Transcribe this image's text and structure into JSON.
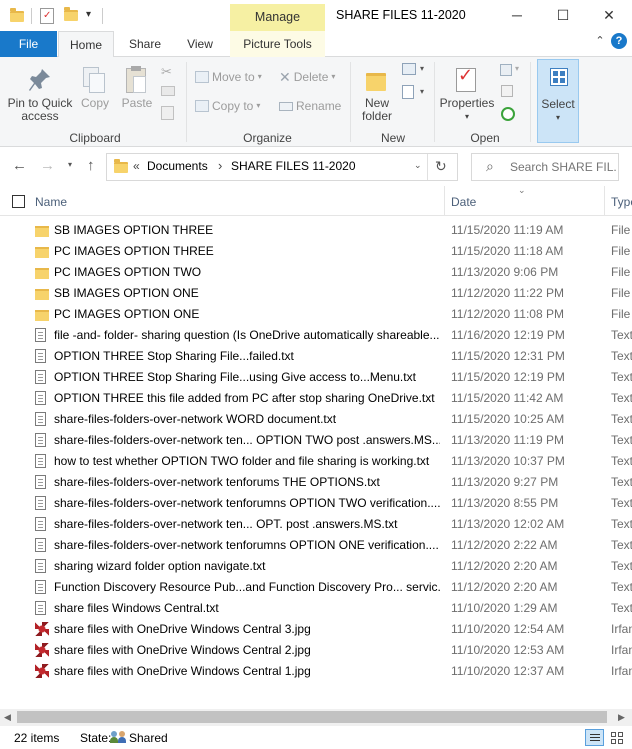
{
  "window": {
    "title": "SHARE FILES 11-2020",
    "manage_label": "Manage",
    "minimize": "─",
    "maximize": "☐",
    "close": "✕"
  },
  "ribbon_tabs": {
    "file": "File",
    "home": "Home",
    "share": "Share",
    "view": "View",
    "picture_tools": "Picture Tools"
  },
  "ribbon": {
    "clipboard": {
      "label": "Clipboard",
      "pin_line1": "Pin to Quick",
      "pin_line2": "access",
      "copy": "Copy",
      "paste": "Paste"
    },
    "organize": {
      "label": "Organize",
      "move_to": "Move to",
      "copy_to": "Copy to",
      "delete": "Delete",
      "rename": "Rename"
    },
    "new": {
      "label": "New",
      "new_folder_line1": "New",
      "new_folder_line2": "folder"
    },
    "open": {
      "label": "Open",
      "properties": "Properties"
    },
    "select": {
      "label": "Select"
    }
  },
  "nav": {
    "breadcrumb_sep": "«",
    "path": [
      "Documents",
      "SHARE FILES 11-2020"
    ],
    "path_arrow": "›",
    "search_placeholder": "Search SHARE FIL..."
  },
  "columns": {
    "name": "Name",
    "date": "Date",
    "type": "Type"
  },
  "files": [
    {
      "name": "SB IMAGES OPTION THREE",
      "date": "11/15/2020 11:19 AM",
      "type": "File",
      "kind": "folder"
    },
    {
      "name": "PC IMAGES OPTION THREE",
      "date": "11/15/2020 11:18 AM",
      "type": "File",
      "kind": "folder"
    },
    {
      "name": "PC IMAGES OPTION TWO",
      "date": "11/13/2020 9:06 PM",
      "type": "File",
      "kind": "folder"
    },
    {
      "name": "SB IMAGES OPTION ONE",
      "date": "11/12/2020 11:22 PM",
      "type": "File",
      "kind": "folder"
    },
    {
      "name": "PC IMAGES OPTION ONE",
      "date": "11/12/2020 11:08 PM",
      "type": "File",
      "kind": "folder"
    },
    {
      "name": "file -and- folder- sharing question (Is OneDrive automatically shareable...",
      "date": "11/16/2020 12:19 PM",
      "type": "Text",
      "kind": "text"
    },
    {
      "name": "OPTION THREE Stop Sharing File...failed.txt",
      "date": "11/15/2020 12:31 PM",
      "type": "Text",
      "kind": "text"
    },
    {
      "name": "OPTION THREE Stop Sharing File...using Give access to...Menu.txt",
      "date": "11/15/2020 12:19 PM",
      "type": "Text",
      "kind": "text"
    },
    {
      "name": "OPTION THREE this file added from PC after stop sharing OneDrive.txt",
      "date": "11/15/2020 11:42 AM",
      "type": "Text",
      "kind": "text"
    },
    {
      "name": "share-files-folders-over-network WORD document.txt",
      "date": "11/15/2020 10:25 AM",
      "type": "Text",
      "kind": "text"
    },
    {
      "name": "share-files-folders-over-network ten... OPTION TWO post .answers.MS....",
      "date": "11/13/2020 11:19 PM",
      "type": "Text",
      "kind": "text"
    },
    {
      "name": "how to test whether OPTION TWO  folder and file sharing is working.txt",
      "date": "11/13/2020 10:37 PM",
      "type": "Text",
      "kind": "text"
    },
    {
      "name": "share-files-folders-over-network tenforums THE OPTIONS.txt",
      "date": "11/13/2020 9:27 PM",
      "type": "Text",
      "kind": "text"
    },
    {
      "name": "share-files-folders-over-network tenforumns OPTION TWO verification....",
      "date": "11/13/2020 8:55 PM",
      "type": "Text",
      "kind": "text"
    },
    {
      "name": "share-files-folders-over-network ten... OPT. post .answers.MS.txt",
      "date": "11/13/2020 12:02 AM",
      "type": "Text",
      "kind": "text"
    },
    {
      "name": "share-files-folders-over-network tenforumns OPTION ONE verification....",
      "date": "11/12/2020 2:22 AM",
      "type": "Text",
      "kind": "text"
    },
    {
      "name": "sharing wizard folder option navigate.txt",
      "date": "11/12/2020 2:20 AM",
      "type": "Text",
      "kind": "text"
    },
    {
      "name": "Function Discovery Resource Pub...and Function Discovery Pro... servic...",
      "date": "11/12/2020 2:20 AM",
      "type": "Text",
      "kind": "text"
    },
    {
      "name": "share files Windows Central.txt",
      "date": "11/10/2020 1:29 AM",
      "type": "Text",
      "kind": "text"
    },
    {
      "name": "share files with OneDrive Windows Central 3.jpg",
      "date": "11/10/2020 12:54 AM",
      "type": "Irfan",
      "kind": "jpg"
    },
    {
      "name": "share files with OneDrive Windows Central 2.jpg",
      "date": "11/10/2020 12:53 AM",
      "type": "Irfan",
      "kind": "jpg"
    },
    {
      "name": "share files with OneDrive Windows Central 1.jpg",
      "date": "11/10/2020 12:37 AM",
      "type": "Irfan",
      "kind": "jpg"
    }
  ],
  "status": {
    "count": "22 items",
    "state_label": "State:",
    "state_value": "Shared"
  },
  "colors": {
    "accent": "#1979ca",
    "manage": "#f6f0a3"
  }
}
